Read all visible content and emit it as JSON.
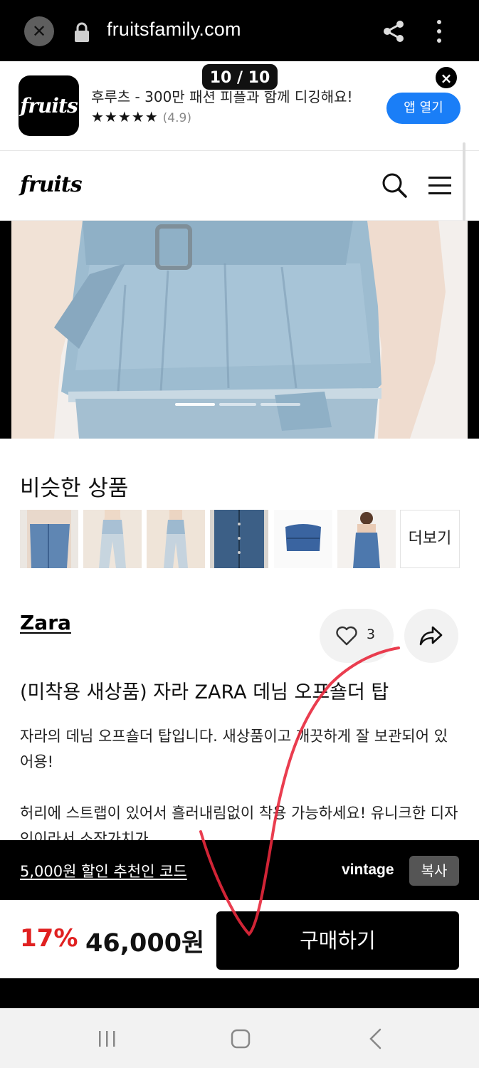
{
  "browser": {
    "url": "fruitsfamily.com"
  },
  "app_banner": {
    "logo_text": "fruits",
    "title": "후루츠 - 300만 패션 피플과 함께 디깅해요!",
    "stars": "★★★★★",
    "rating": "(4.9)",
    "open_label": "앱 열기",
    "close_label": "×"
  },
  "page_counter": "10 / 10",
  "site": {
    "logo_text": "fruits"
  },
  "similar": {
    "title": "비슷한 상품",
    "more_label": "더보기"
  },
  "product": {
    "brand": "Zara",
    "like_count": "3",
    "title": "(미착용 새상품) 자라 ZARA 데님 오프숄더 탑",
    "description_1": "자라의 데님 오프숄더 탑입니다. 새상품이고 깨끗하게 잘 보관되어 있어용!",
    "description_2": "허리에 스트랩이 있어서 흘러내림없이 착용 가능하세요! 유니크한 디자인이라서 소장가치가"
  },
  "referral": {
    "link_label": "5,000원 할인 추천인 코드",
    "code": "vintage",
    "copy_label": "복사"
  },
  "purchase": {
    "discount": "17%",
    "price": "46,000원",
    "buy_label": "구매하기"
  },
  "colors": {
    "accent_blue": "#1a7ef7",
    "discount_red": "#e02020",
    "annotation_red": "#e8283c"
  }
}
